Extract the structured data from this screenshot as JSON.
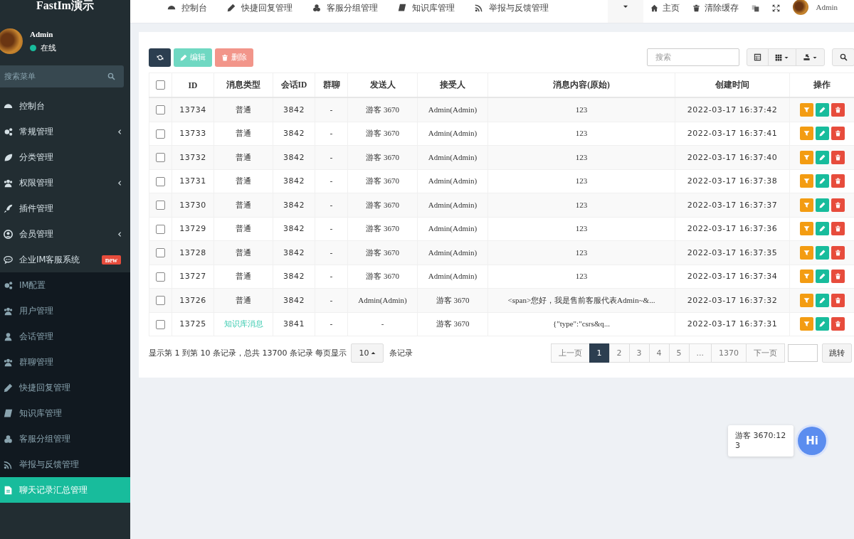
{
  "sidebar": {
    "brand": "FastIm演示",
    "user": {
      "name": "Admin",
      "status": "在线",
      "online": true
    },
    "search": {
      "placeholder": "搜索菜单"
    },
    "items": [
      {
        "label": "控制台",
        "arrow": false,
        "selected": false
      },
      {
        "label": "常规管理",
        "arrow": true,
        "selected": false
      },
      {
        "label": "分类管理",
        "arrow": false,
        "selected": false
      },
      {
        "label": "权限管理",
        "arrow": true,
        "selected": false
      },
      {
        "label": "插件管理",
        "arrow": false,
        "selected": false
      },
      {
        "label": "会员管理",
        "arrow": true,
        "selected": false
      },
      {
        "label": "企业IM客服系统",
        "arrow": false,
        "badge": "new",
        "selected": false,
        "expanded": true,
        "children": [
          {
            "label": "IM配置",
            "selected": false
          },
          {
            "label": "用户管理",
            "selected": false
          },
          {
            "label": "会话管理",
            "selected": false
          },
          {
            "label": "群聊管理",
            "selected": false
          },
          {
            "label": "快捷回复管理",
            "selected": false
          },
          {
            "label": "知识库管理",
            "selected": false
          },
          {
            "label": "客服分组管理",
            "selected": false
          },
          {
            "label": "举报与反馈管理",
            "selected": false
          },
          {
            "label": "聊天记录汇总管理",
            "selected": true
          }
        ]
      }
    ]
  },
  "topnav": {
    "tabs": [
      "控制台",
      "快捷回复管理",
      "客服分组管理",
      "知识库管理",
      "举报与反馈管理"
    ],
    "right": [
      "主页",
      "清除缓存"
    ],
    "user": "Admin"
  },
  "toolbar": {
    "buttons": [
      {
        "kind": "refresh"
      },
      {
        "kind": "edit",
        "label": "编辑"
      },
      {
        "kind": "delete",
        "label": "删除"
      }
    ],
    "search": {
      "placeholder": "搜索"
    }
  },
  "table": {
    "all_checked": false,
    "columns": [
      "ID",
      "消息类型",
      "会话ID",
      "群聊",
      "发送人",
      "接受人",
      "消息内容(原始)",
      "创建时间",
      "操作"
    ],
    "rows": [
      {
        "checked": false,
        "id": "13734",
        "type": "普通",
        "type_link": false,
        "session": "3842",
        "group": "-",
        "sender": "游客 3670",
        "receiver": "Admin(Admin)",
        "content": "123",
        "time": "2022-03-17 16:37:42"
      },
      {
        "checked": false,
        "id": "13733",
        "type": "普通",
        "type_link": false,
        "session": "3842",
        "group": "-",
        "sender": "游客 3670",
        "receiver": "Admin(Admin)",
        "content": "123",
        "time": "2022-03-17 16:37:41"
      },
      {
        "checked": false,
        "id": "13732",
        "type": "普通",
        "type_link": false,
        "session": "3842",
        "group": "-",
        "sender": "游客 3670",
        "receiver": "Admin(Admin)",
        "content": "123",
        "time": "2022-03-17 16:37:40"
      },
      {
        "checked": false,
        "id": "13731",
        "type": "普通",
        "type_link": false,
        "session": "3842",
        "group": "-",
        "sender": "游客 3670",
        "receiver": "Admin(Admin)",
        "content": "123",
        "time": "2022-03-17 16:37:38"
      },
      {
        "checked": false,
        "id": "13730",
        "type": "普通",
        "type_link": false,
        "session": "3842",
        "group": "-",
        "sender": "游客 3670",
        "receiver": "Admin(Admin)",
        "content": "123",
        "time": "2022-03-17 16:37:37"
      },
      {
        "checked": false,
        "id": "13729",
        "type": "普通",
        "type_link": false,
        "session": "3842",
        "group": "-",
        "sender": "游客 3670",
        "receiver": "Admin(Admin)",
        "content": "123",
        "time": "2022-03-17 16:37:36"
      },
      {
        "checked": false,
        "id": "13728",
        "type": "普通",
        "type_link": false,
        "session": "3842",
        "group": "-",
        "sender": "游客 3670",
        "receiver": "Admin(Admin)",
        "content": "123",
        "time": "2022-03-17 16:37:35"
      },
      {
        "checked": false,
        "id": "13727",
        "type": "普通",
        "type_link": false,
        "session": "3842",
        "group": "-",
        "sender": "游客 3670",
        "receiver": "Admin(Admin)",
        "content": "123",
        "time": "2022-03-17 16:37:34"
      },
      {
        "checked": false,
        "id": "13726",
        "type": "普通",
        "type_link": false,
        "session": "3842",
        "group": "-",
        "sender": "Admin(Admin)",
        "receiver": "游客 3670",
        "content": "<span>您好，我是售前客服代表Admin~&...",
        "time": "2022-03-17 16:37:32"
      },
      {
        "checked": false,
        "id": "13725",
        "type": "知识库消息",
        "type_link": true,
        "session": "3841",
        "group": "-",
        "sender": "-",
        "receiver": "游客 3670",
        "content": "{\"type\":\"csrs&q...",
        "time": "2022-03-17 16:37:31"
      }
    ]
  },
  "footer": {
    "summary": "显示第 1 到第 10 条记录，总共 13700 条记录 每页显示",
    "page_size": "10",
    "suffix": "条记录",
    "pages": [
      {
        "label": "上一页",
        "selected": false
      },
      {
        "label": "1",
        "selected": true
      },
      {
        "label": "2",
        "selected": false
      },
      {
        "label": "3",
        "selected": false
      },
      {
        "label": "4",
        "selected": false
      },
      {
        "label": "5",
        "selected": false
      },
      {
        "label": "...",
        "selected": false
      },
      {
        "label": "1370",
        "selected": false
      },
      {
        "label": "下一页",
        "selected": false
      }
    ],
    "jump": "跳转"
  },
  "chat": {
    "message": "游客 3670:123",
    "button": "Hi"
  }
}
